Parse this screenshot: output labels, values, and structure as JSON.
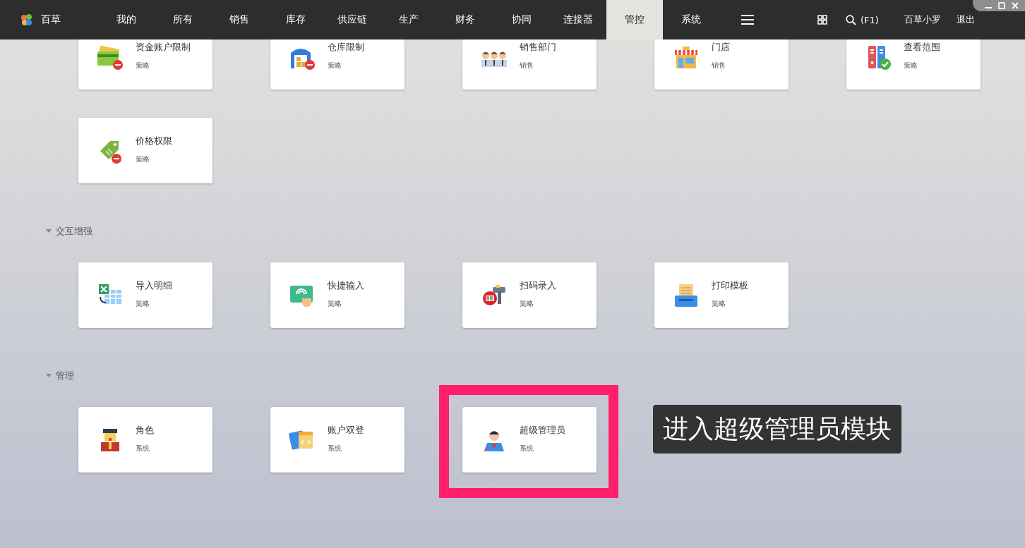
{
  "app": {
    "name": "百草"
  },
  "nav": [
    {
      "label": "我的",
      "selected": false
    },
    {
      "label": "所有",
      "selected": false
    },
    {
      "label": "销售",
      "selected": false
    },
    {
      "label": "库存",
      "selected": false
    },
    {
      "label": "供应链",
      "selected": false
    },
    {
      "label": "生产",
      "selected": false
    },
    {
      "label": "财务",
      "selected": false
    },
    {
      "label": "协同",
      "selected": false
    },
    {
      "label": "连接器",
      "selected": false
    },
    {
      "label": "管控",
      "selected": true
    },
    {
      "label": "系统",
      "selected": false
    }
  ],
  "toolbar": {
    "search_shortcut": "(F1)",
    "user": "百草小罗",
    "logout": "退出"
  },
  "sections": [
    {
      "cards": [
        {
          "kind": "card",
          "title": "资金账户限制",
          "subtitle": "策略"
        },
        {
          "kind": "warehouse",
          "title": "仓库限制",
          "subtitle": "策略"
        },
        {
          "kind": "people",
          "title": "销售部门",
          "subtitle": "销售"
        },
        {
          "kind": "store",
          "title": "门店",
          "subtitle": "销售"
        },
        {
          "kind": "server",
          "title": "查看范围",
          "subtitle": "策略"
        },
        {
          "kind": "tag",
          "title": "价格权限",
          "subtitle": "策略"
        }
      ]
    },
    {
      "title": "交互增强",
      "expanded": true,
      "cards": [
        {
          "kind": "sheet",
          "title": "导入明细",
          "subtitle": "策略"
        },
        {
          "kind": "touch",
          "title": "快捷输入",
          "subtitle": "策略"
        },
        {
          "kind": "scanner",
          "title": "扫码录入",
          "subtitle": "策略"
        },
        {
          "kind": "printer",
          "title": "打印模板",
          "subtitle": "策略"
        }
      ]
    },
    {
      "title": "管理",
      "expanded": true,
      "cards": [
        {
          "kind": "role",
          "title": "角色",
          "subtitle": "系统"
        },
        {
          "kind": "windows",
          "title": "账户双登",
          "subtitle": "系统"
        },
        {
          "kind": "admin",
          "title": "超级管理员",
          "subtitle": "系统",
          "highlighted": true
        }
      ]
    }
  ],
  "callout": "进入超级管理员模块"
}
